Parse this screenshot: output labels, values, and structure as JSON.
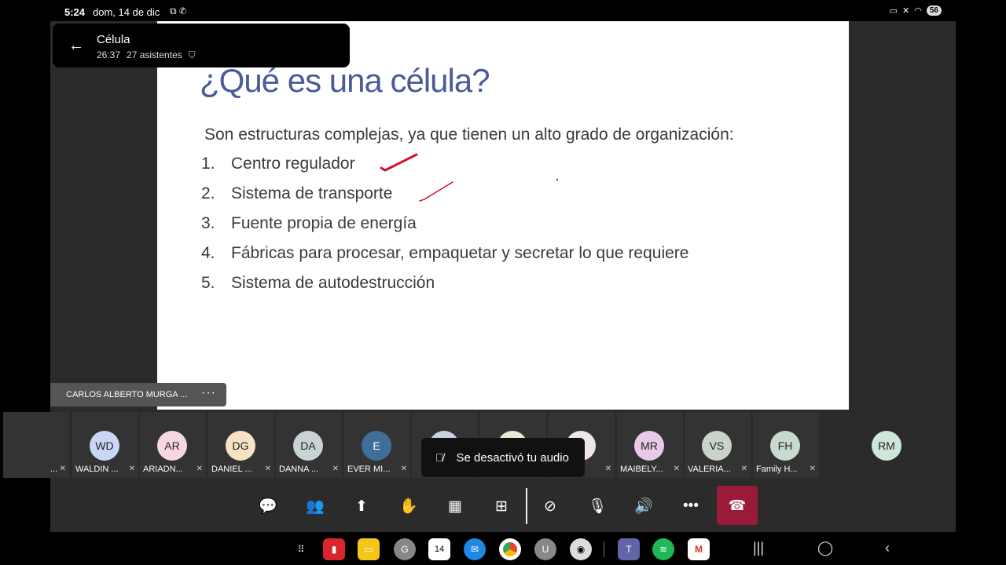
{
  "status_bar": {
    "time": "5:24",
    "date": "dom, 14 de dic",
    "battery": "56"
  },
  "call": {
    "title": "Célula",
    "duration": "26:37",
    "attendees": "27 asistentes"
  },
  "slide": {
    "title": "¿Qué es una célula?",
    "intro": "Son estructuras complejas, ya que tienen un alto grado de organización:",
    "items": [
      {
        "num": "1.",
        "text": "Centro regulador"
      },
      {
        "num": "2.",
        "text": "Sistema de transporte"
      },
      {
        "num": "3.",
        "text": "Fuente propia de energía"
      },
      {
        "num": "4.",
        "text": "Fábricas para procesar, empaquetar y secretar lo que requiere"
      },
      {
        "num": "5.",
        "text": "Sistema de autodestrucción"
      }
    ],
    "ink_color": "#d0102a"
  },
  "presenter": {
    "name": "CARLOS ALBERTO MURGA ...",
    "more": "···"
  },
  "participants": [
    {
      "initials": "",
      "name": "...",
      "color": "#333333"
    },
    {
      "initials": "WD",
      "name": "WALDIN ...",
      "color": "#c9d6f5"
    },
    {
      "initials": "AR",
      "name": "ARIADN...",
      "color": "#f7d7e0"
    },
    {
      "initials": "DG",
      "name": "DANIEL ...",
      "color": "#f6e3c4"
    },
    {
      "initials": "DA",
      "name": "DANNA ...",
      "color": "#c8d3d6"
    },
    {
      "initials": "E",
      "name": "EVER MI...",
      "color": "#3f6f99"
    },
    {
      "initials": "",
      "name": "",
      "color": "#c9d2e0"
    },
    {
      "initials": "",
      "name": "",
      "color": "#e6ead8"
    },
    {
      "initials": "M",
      "name": "...IA...",
      "color": "#efe4e8"
    },
    {
      "initials": "MR",
      "name": "MAIBELY...",
      "color": "#e9c9e7"
    },
    {
      "initials": "VS",
      "name": "VALERIA...",
      "color": "#c9d3c9"
    },
    {
      "initials": "FH",
      "name": "Family H...",
      "color": "#c8d9d0"
    },
    {
      "initials": "RM",
      "name": "",
      "color": "#cfe6da"
    }
  ],
  "toast": {
    "text": "Se desactivó tu audio"
  },
  "controls": {
    "buttons": [
      "chat-icon",
      "people-icon",
      "share-icon",
      "raise-hand-icon",
      "apps-icon",
      "layout-icon",
      "camera-off-icon",
      "mic-off-icon",
      "speaker-icon",
      "more-icon"
    ],
    "hangup_color": "#9a1a3a"
  },
  "taskbar": {
    "calendar_day": "14",
    "calendar_month": "DOM",
    "badge_count": "1"
  }
}
